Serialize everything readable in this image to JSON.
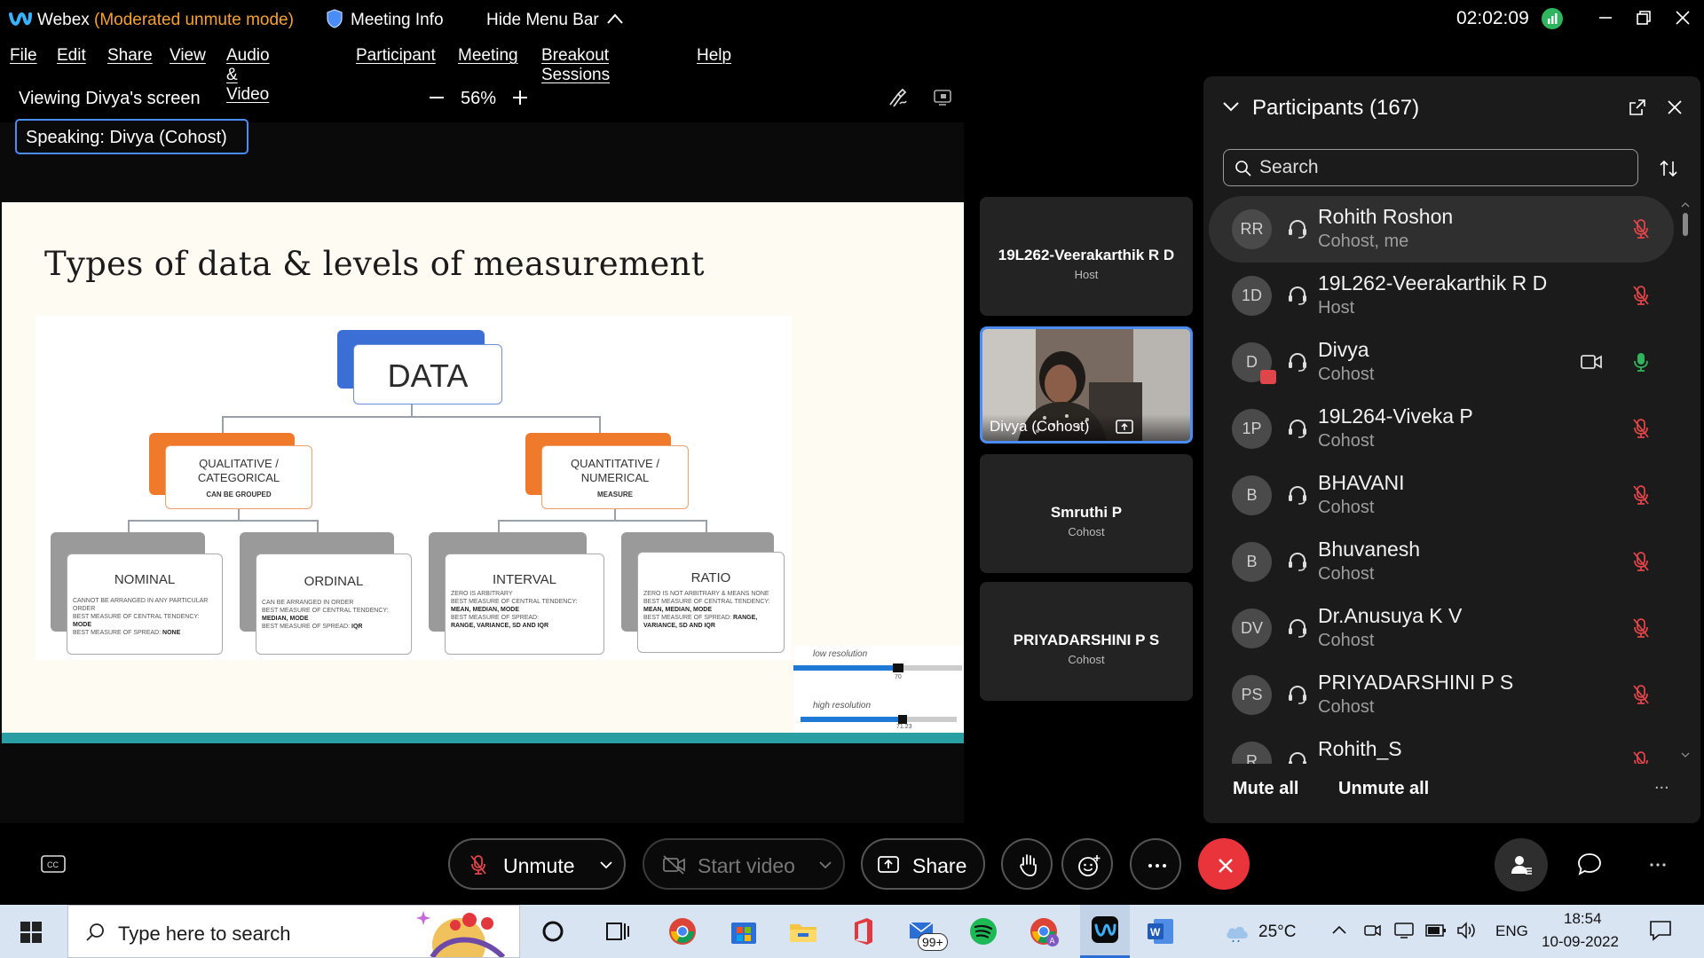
{
  "titlebar": {
    "app_name": "Webex",
    "mode": "(Moderated unmute mode)",
    "meeting_info": "Meeting Info",
    "hide_menu_bar": "Hide Menu Bar",
    "clock": "02:02:09"
  },
  "menu": [
    "File",
    "Edit",
    "Share",
    "View",
    "Audio & Video",
    "Participant",
    "Meeting",
    "Breakout Sessions",
    "Help"
  ],
  "share_view": {
    "viewing": "Viewing Divya's screen",
    "zoom": "56%",
    "speaking_label": "Speaking:",
    "speaking_name": "Divya (Cohost)"
  },
  "slide": {
    "title": "Types of data & levels of measurement",
    "root": "DATA",
    "qual_title": "QUALITATIVE /\nCATEGORICAL",
    "qual_sub": "CAN BE GROUPED",
    "quant_title": "QUANTITATIVE /\nNUMERICAL",
    "quant_sub": "MEASURE",
    "nominal": {
      "title": "NOMINAL",
      "note1": "CANNOT BE ARRANGED IN ANY PARTICULAR ORDER",
      "note2": "BEST MEASURE OF CENTRAL TENDENCY:",
      "note3": "MODE",
      "note4": "BEST MEASURE OF SPREAD:",
      "note5": "NONE"
    },
    "ordinal": {
      "title": "ORDINAL",
      "note1": "CAN BE ARRANGED IN ORDER",
      "note2": "BEST MEASURE OF CENTRAL TENDENCY:",
      "note3": "MEDIAN, MODE",
      "note4": "BEST MEASURE OF SPREAD:",
      "note5": "IQR"
    },
    "interval": {
      "title": "INTERVAL",
      "note1": "ZERO IS ARBITRARY",
      "note2": "BEST MEASURE OF CENTRAL TENDENCY:",
      "note3": "MEAN, MEDIAN, MODE",
      "note4": "BEST MEASURE OF SPREAD:",
      "note5": "RANGE, VARIANCE, SD AND IQR"
    },
    "ratio": {
      "title": "RATIO",
      "note1": "ZERO IS NOT ARBITRARY & MEANS NONE",
      "note2": "BEST MEASURE OF CENTRAL TENDENCY:",
      "note3": "MEAN, MEDIAN, MODE",
      "note4": "BEST MEASURE OF SPREAD:",
      "note5": "RANGE, VARIANCE, SD AND IQR"
    },
    "low_res": "low resolution",
    "low_res_val": "70",
    "high_res": "high resolution",
    "high_res_val": "71.23"
  },
  "thumbnails": [
    {
      "name": "19L262-Veerakarthik R D",
      "role": "Host"
    },
    {
      "name": "Divya (Cohost)",
      "role": ""
    },
    {
      "name": "Smruthi P",
      "role": "Cohost"
    },
    {
      "name": "PRIYADARSHINI P S",
      "role": "Cohost"
    }
  ],
  "participants": {
    "title": "Participants (167)",
    "search_placeholder": "Search",
    "list": [
      {
        "initials": "RR",
        "name": "Rohith Roshon",
        "role": "Cohost, me",
        "mic": "muted",
        "selected": true
      },
      {
        "initials": "1D",
        "name": "19L262-Veerakarthik R D",
        "role": "Host",
        "mic": "muted"
      },
      {
        "initials": "D",
        "name": "Divya",
        "role": "Cohost",
        "mic": "on",
        "video": true
      },
      {
        "initials": "1P",
        "name": "19L264-Viveka P",
        "role": "Cohost",
        "mic": "muted"
      },
      {
        "initials": "B",
        "name": "BHAVANI",
        "role": "Cohost",
        "mic": "muted"
      },
      {
        "initials": "B",
        "name": "Bhuvanesh",
        "role": "Cohost",
        "mic": "muted"
      },
      {
        "initials": "DV",
        "name": "Dr.Anusuya K V",
        "role": "Cohost",
        "mic": "muted"
      },
      {
        "initials": "PS",
        "name": "PRIYADARSHINI P S",
        "role": "Cohost",
        "mic": "muted"
      },
      {
        "initials": "R",
        "name": "Rohith_S",
        "role": "",
        "mic": "muted"
      }
    ],
    "mute_all": "Mute all",
    "unmute_all": "Unmute all",
    "more": "..."
  },
  "controls": {
    "unmute": "Unmute",
    "start_video": "Start video",
    "share": "Share"
  },
  "taskbar": {
    "search_placeholder": "Type here to search",
    "mail_badge": "99+",
    "temperature": "25°C",
    "language": "ENG",
    "time": "18:54",
    "date": "10-09-2022"
  },
  "colors": {
    "accent_blue": "#4a8df6",
    "mode_orange": "#f7a12f",
    "end_red": "#e8343a",
    "muted_red": "#e0454a",
    "mic_green": "#2fb55d"
  }
}
